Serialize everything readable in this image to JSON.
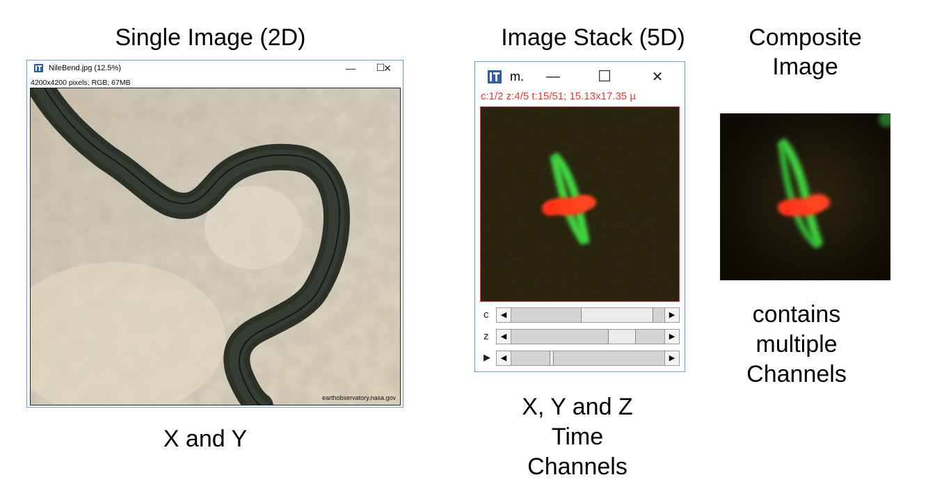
{
  "headings": {
    "single": "Single Image (2D)",
    "stack": "Image Stack (5D)",
    "composite_line1": "Composite",
    "composite_line2": "Image"
  },
  "window_2d": {
    "title": "NileBend.jpg (12.5%)",
    "info": "4200x4200 pixels; RGB; 67MB",
    "credit": "earthobservatory.nasa.gov",
    "controls": {
      "minimize": "—",
      "maximize": "☐",
      "close": "✕"
    },
    "icon": "imagej-icon"
  },
  "window_5d": {
    "title": "m.",
    "info": "c:1/2 z:4/5 t:15/51; 15.13x17.35 µ",
    "controls": {
      "minimize": "—",
      "maximize": "☐",
      "close": "✕"
    },
    "icon": "imagej-icon",
    "sliders": [
      {
        "label": "c",
        "position": 0.5
      },
      {
        "label": "z",
        "position": 0.75
      },
      {
        "label": "▶",
        "position": 0.29
      }
    ],
    "arrow_left": "◀",
    "arrow_right": "▶"
  },
  "captions": {
    "single": "X and Y",
    "stack": [
      "X, Y and Z",
      "Time",
      "Channels"
    ],
    "composite": [
      "contains",
      "multiple",
      "Channels"
    ]
  },
  "colors": {
    "window_border": "#6b9bd1",
    "info_red": "#e33333",
    "green_channel": "#3fd43f",
    "red_channel": "#ff3a1a"
  }
}
